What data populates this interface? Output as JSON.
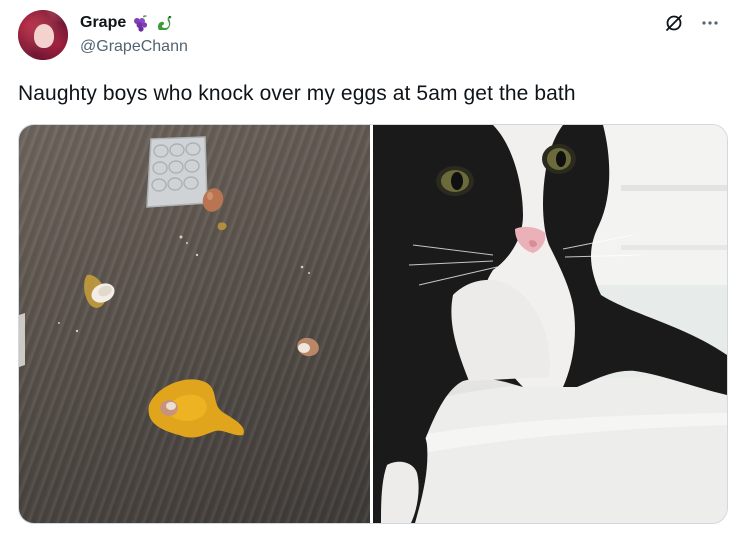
{
  "user": {
    "display_name": "Grape",
    "handle": "@GrapeChann",
    "badges": [
      "grapes-emoji",
      "dragon-emoji"
    ]
  },
  "tweet": {
    "text": "Naughty boys who knock over my eggs at 5am get the bath"
  },
  "icons": {
    "grok": "grok-icon",
    "more": "more-icon"
  },
  "colors": {
    "text_primary": "#0f1419",
    "text_secondary": "#536471",
    "border": "#cfd9de"
  }
}
